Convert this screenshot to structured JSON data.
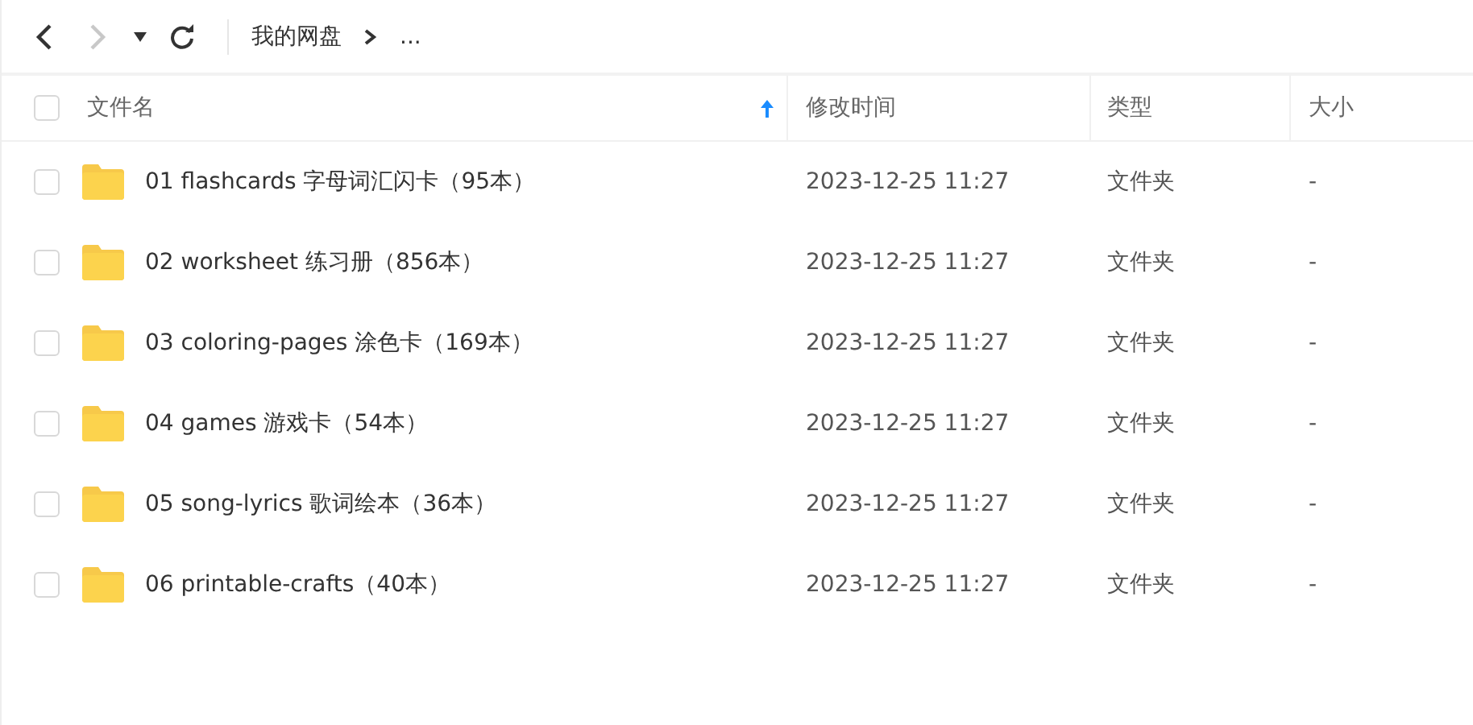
{
  "toolbar": {
    "back": {
      "disabled": false
    },
    "forward": {
      "disabled": true
    },
    "breadcrumb": [
      {
        "label": "我的网盘"
      },
      {
        "label": "..."
      }
    ]
  },
  "table": {
    "header_checkbox": {
      "checked": false
    },
    "columns": [
      {
        "label": "文件名",
        "sorted": true
      },
      {
        "label": "修改时间",
        "sorted": false
      },
      {
        "label": "类型",
        "sorted": false
      },
      {
        "label": "大小",
        "sorted": false
      }
    ],
    "rows": [
      {
        "checked": false,
        "name": "01 flashcards 字母词汇闪卡（95本）",
        "modified": "2023-12-25 11:27",
        "type": "文件夹",
        "size": "-"
      },
      {
        "checked": false,
        "name": "02 worksheet 练习册（856本）",
        "modified": "2023-12-25 11:27",
        "type": "文件夹",
        "size": "-"
      },
      {
        "checked": false,
        "name": "03 coloring-pages 涂色卡（169本）",
        "modified": "2023-12-25 11:27",
        "type": "文件夹",
        "size": "-"
      },
      {
        "checked": false,
        "name": "04 games 游戏卡（54本）",
        "modified": "2023-12-25 11:27",
        "type": "文件夹",
        "size": "-"
      },
      {
        "checked": false,
        "name": "05 song-lyrics 歌词绘本（36本）",
        "modified": "2023-12-25 11:27",
        "type": "文件夹",
        "size": "-"
      },
      {
        "checked": false,
        "name": "06 printable-crafts（40本）",
        "modified": "2023-12-25 11:27",
        "type": "文件夹",
        "size": "-"
      }
    ]
  }
}
